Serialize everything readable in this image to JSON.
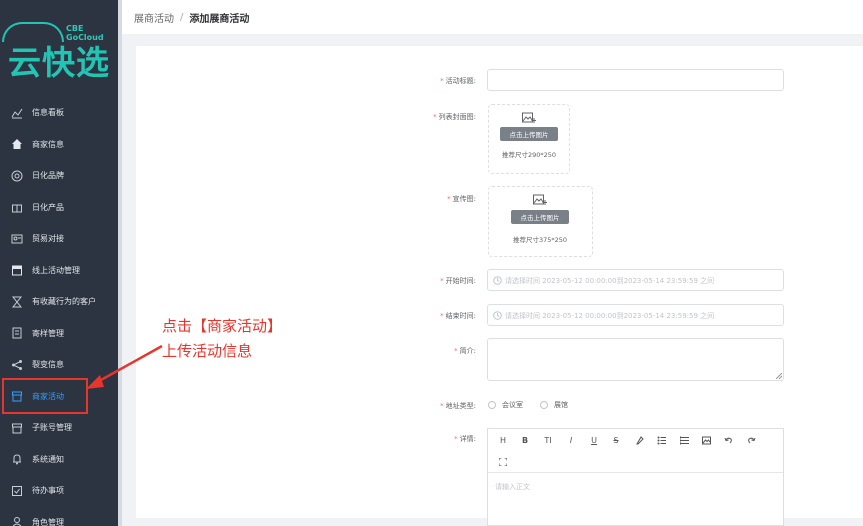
{
  "logo": {
    "brand": "CBE GoCloud",
    "name": "云快选"
  },
  "sidebar": {
    "items": [
      {
        "label": "信息看板",
        "icon": "chart-icon"
      },
      {
        "label": "商家信息",
        "icon": "home-icon"
      },
      {
        "label": "日化品牌",
        "icon": "badge-icon"
      },
      {
        "label": "日化产品",
        "icon": "gift-icon"
      },
      {
        "label": "贸易对接",
        "icon": "id-card-icon"
      },
      {
        "label": "线上活动管理",
        "icon": "calendar-icon"
      },
      {
        "label": "有收藏行为的客户",
        "icon": "hourglass-icon"
      },
      {
        "label": "寄样管理",
        "icon": "document-icon"
      },
      {
        "label": "裂变信息",
        "icon": "share-icon"
      },
      {
        "label": "商家活动",
        "icon": "store-icon",
        "active": true
      },
      {
        "label": "子账号管理",
        "icon": "store-icon"
      },
      {
        "label": "系统通知",
        "icon": "bell-icon"
      },
      {
        "label": "待办事项",
        "icon": "checklist-icon"
      },
      {
        "label": "角色管理",
        "icon": "user-icon"
      }
    ],
    "active_color": "#3b9cff"
  },
  "breadcrumb": {
    "parent": "展商活动",
    "separator": "/",
    "current": "添加展商活动"
  },
  "form": {
    "title_label": "活动标题:",
    "cover_label": "列表封面图:",
    "cover_upload_btn": "点击上传图片",
    "cover_hint": "推荐尺寸290*250",
    "promo_label": "宣传图:",
    "promo_upload_btn": "点击上传图片",
    "promo_hint": "推荐尺寸375*250",
    "start_label": "开始时间:",
    "start_placeholder": "请选择时间 2023-05-12 00:00:00到2023-05-14 23:59:59 之间",
    "end_label": "结束时间:",
    "end_placeholder": "请选择时间 2023-05-12 00:00:00到2023-05-14 23:59:59 之间",
    "intro_label": "简介:",
    "address_label": "地址类型:",
    "address_options": [
      "会议室",
      "展馆"
    ],
    "detail_label": "详情:",
    "editor_placeholder": "请输入正文",
    "toolbar": [
      "H",
      "B",
      "TI",
      "I",
      "U",
      "S"
    ]
  },
  "annotation": {
    "line1": "点击【商家活动】",
    "line2": "上传活动信息",
    "color": "#e8352b"
  }
}
